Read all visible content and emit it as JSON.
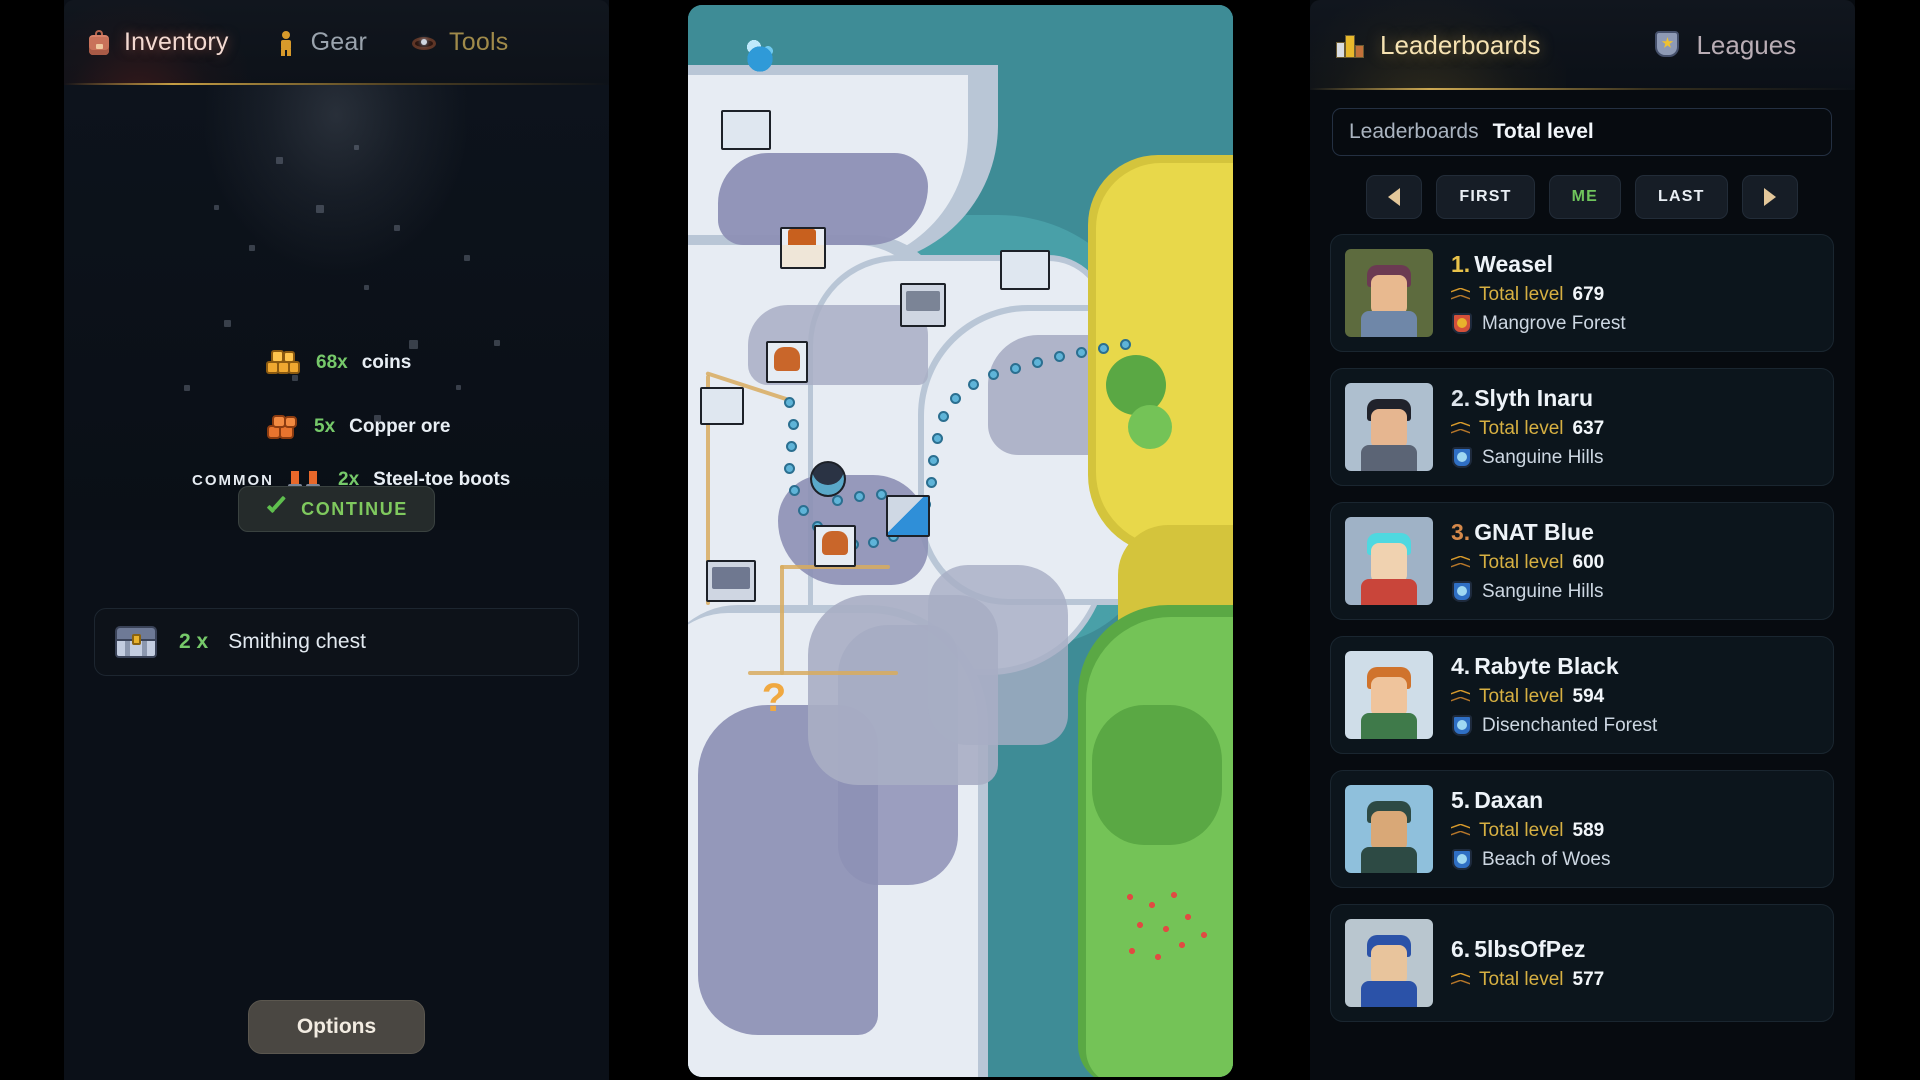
{
  "left_panel": {
    "tabs": [
      {
        "label": "Inventory",
        "icon": "backpack-icon",
        "active": true
      },
      {
        "label": "Gear",
        "icon": "person-icon",
        "active": false
      },
      {
        "label": "Tools",
        "icon": "ring-icon",
        "active": false
      }
    ],
    "rewards": [
      {
        "qty": "68x",
        "name": "coins",
        "icon": "coins-icon",
        "rarity": ""
      },
      {
        "qty": "5x",
        "name": "Copper ore",
        "icon": "copper-ore-icon",
        "rarity": ""
      },
      {
        "qty": "2x",
        "name": "Steel-toe boots",
        "icon": "boots-icon",
        "rarity": "COMMON"
      }
    ],
    "drop_icon": "armor-plate-icon",
    "continue_button": {
      "label": "CONTINUE",
      "icon": "check-icon"
    },
    "chest_card": {
      "qty": "2 x",
      "name": "Smithing chest",
      "icon": "chest-icon"
    },
    "options_button": {
      "label": "Options"
    }
  },
  "map_panel": {
    "name": "world-map",
    "colors": {
      "ocean_deep": "#3e8c96",
      "ocean_light": "#49a0a8",
      "snow": "#e7ecf3",
      "grass": "#74c357",
      "sand": "#e8d84a",
      "mountain": "#a8aec4",
      "road": "#d8ab5e",
      "path_dot": "#5fb4d8"
    }
  },
  "right_panel": {
    "tabs": [
      {
        "label": "Leaderboards",
        "icon": "podium-icon",
        "active": true
      },
      {
        "label": "Leagues",
        "icon": "shield-star-icon",
        "active": false
      }
    ],
    "breadcrumb": {
      "root": "Leaderboards",
      "current": "Total level"
    },
    "nav": {
      "prev_icon": "triangle-left-icon",
      "first": "FIRST",
      "me": "ME",
      "last": "LAST",
      "next_icon": "triangle-right-icon"
    },
    "metric_label": "Total level",
    "entries": [
      {
        "rank": "1.",
        "rank_color": "#e8c24a",
        "name": "Weasel",
        "metric_label": "Total level",
        "metric_value": "679",
        "location": "Mangrove Forest",
        "badge_color": "#d4503a",
        "badge_inner": "#e8b22c",
        "avatar": {
          "bg": "#5d6b3e",
          "hair": "#6b3a52",
          "skin": "#e8b98f",
          "body": "#6f87a8"
        }
      },
      {
        "rank": "2.",
        "rank_color": "#dfe5ec",
        "name": "Slyth Inaru",
        "metric_label": "Total level",
        "metric_value": "637",
        "location": "Sanguine Hills",
        "badge_color": "#2f6fc4",
        "badge_inner": "#9fd8f2",
        "avatar": {
          "bg": "#aebfcf",
          "hair": "#20222b",
          "skin": "#e6b690",
          "body": "#5b6475"
        }
      },
      {
        "rank": "3.",
        "rank_color": "#d4884a",
        "name": "GNAT Blue",
        "metric_label": "Total level",
        "metric_value": "600",
        "location": "Sanguine Hills",
        "badge_color": "#2f6fc4",
        "badge_inner": "#9fd8f2",
        "avatar": {
          "bg": "#9fb2c6",
          "hair": "#4fd8e0",
          "skin": "#f0d2b0",
          "body": "#c9453a"
        }
      },
      {
        "rank": "4.",
        "rank_color": "#eef3f8",
        "name": "Rabyte Black",
        "metric_label": "Total level",
        "metric_value": "594",
        "location": "Disenchanted Forest",
        "badge_color": "#2f6fc4",
        "badge_inner": "#9fd8f2",
        "avatar": {
          "bg": "#cfdde8",
          "hair": "#d0732c",
          "skin": "#efc49c",
          "body": "#3f7a4a"
        }
      },
      {
        "rank": "5.",
        "rank_color": "#eef3f8",
        "name": "Daxan",
        "metric_label": "Total level",
        "metric_value": "589",
        "location": "Beach of Woes",
        "badge_color": "#2f6fc4",
        "badge_inner": "#9fd8f2",
        "avatar": {
          "bg": "#8fc0dc",
          "hair": "#2d4a44",
          "skin": "#d9a877",
          "body": "#2d4a44"
        }
      },
      {
        "rank": "6.",
        "rank_color": "#eef3f8",
        "name": "5lbsOfPez",
        "metric_label": "Total level",
        "metric_value": "577",
        "location": "",
        "badge_color": "#2f6fc4",
        "badge_inner": "#9fd8f2",
        "avatar": {
          "bg": "#b9c6cf",
          "hair": "#2b52a8",
          "skin": "#e8c49c",
          "body": "#2b52a8"
        }
      }
    ]
  }
}
